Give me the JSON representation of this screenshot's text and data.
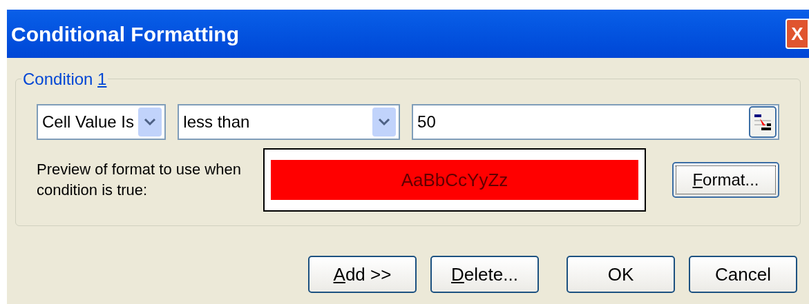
{
  "window": {
    "title": "Conditional Formatting",
    "close_label": "X"
  },
  "condition": {
    "legend": "Condition ",
    "legend_mnemonic": "1",
    "field_type": {
      "value": "Cell Value Is"
    },
    "operator": {
      "value": "less than"
    },
    "value_field": {
      "value": "50"
    },
    "preview_label": "Preview of format to use when condition is true:",
    "preview_text": "AaBbCcYyZz",
    "format_button": {
      "mnemonic": "F",
      "rest": "ormat...",
      "focused": true
    }
  },
  "buttons": [
    {
      "mnemonic": "A",
      "rest": "dd >>"
    },
    {
      "mnemonic": "D",
      "rest": "elete..."
    },
    {
      "rest": "OK"
    },
    {
      "rest": "Cancel"
    }
  ]
}
